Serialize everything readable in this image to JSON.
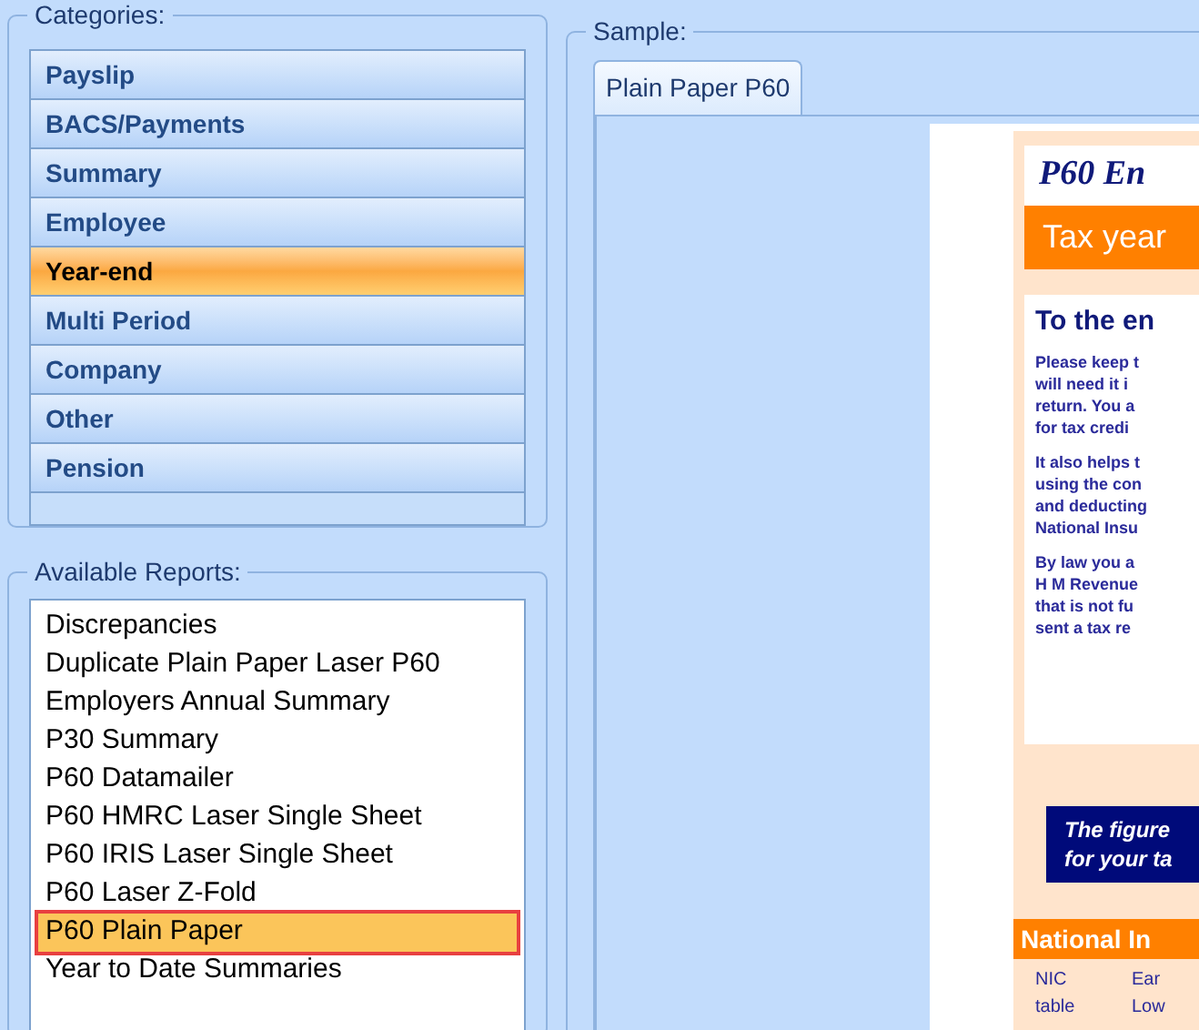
{
  "categories": {
    "label": "Categories:",
    "items": [
      {
        "label": "Payslip",
        "selected": false
      },
      {
        "label": "BACS/Payments",
        "selected": false
      },
      {
        "label": "Summary",
        "selected": false
      },
      {
        "label": "Employee",
        "selected": false
      },
      {
        "label": "Year-end",
        "selected": true
      },
      {
        "label": "Multi Period",
        "selected": false
      },
      {
        "label": "Company",
        "selected": false
      },
      {
        "label": "Other",
        "selected": false
      },
      {
        "label": "Pension",
        "selected": false
      }
    ]
  },
  "reports": {
    "label": "Available Reports:",
    "items": [
      {
        "label": "Discrepancies",
        "selected": false
      },
      {
        "label": "Duplicate Plain Paper Laser P60",
        "selected": false
      },
      {
        "label": "Employers Annual Summary",
        "selected": false
      },
      {
        "label": "P30 Summary",
        "selected": false
      },
      {
        "label": "P60 Datamailer",
        "selected": false
      },
      {
        "label": "P60 HMRC Laser Single Sheet",
        "selected": false
      },
      {
        "label": "P60 IRIS Laser Single Sheet",
        "selected": false
      },
      {
        "label": "P60 Laser Z-Fold",
        "selected": false
      },
      {
        "label": "P60 Plain Paper",
        "selected": true
      },
      {
        "label": "Year to Date Summaries",
        "selected": false
      }
    ]
  },
  "sample": {
    "label": "Sample:",
    "tabs": [
      {
        "label": "Plain Paper P60",
        "selected": true
      }
    ],
    "document": {
      "title": "P60 En",
      "tax_year": "Tax year",
      "heading": "To the en",
      "paragraphs": [
        [
          "Please keep t",
          "will need it i",
          "return. You a",
          "for tax credi"
        ],
        [
          "It also helps t",
          "using the con",
          "and deducting",
          "National Insu"
        ],
        [
          "By law you a",
          "H M Revenue",
          "that is not fu",
          "sent a tax re"
        ]
      ],
      "notice": [
        "The figure",
        "for your ta"
      ],
      "section": "National In",
      "table_columns": [
        [
          "NIC",
          "table"
        ],
        [
          "Ear",
          "Low"
        ]
      ]
    }
  }
}
